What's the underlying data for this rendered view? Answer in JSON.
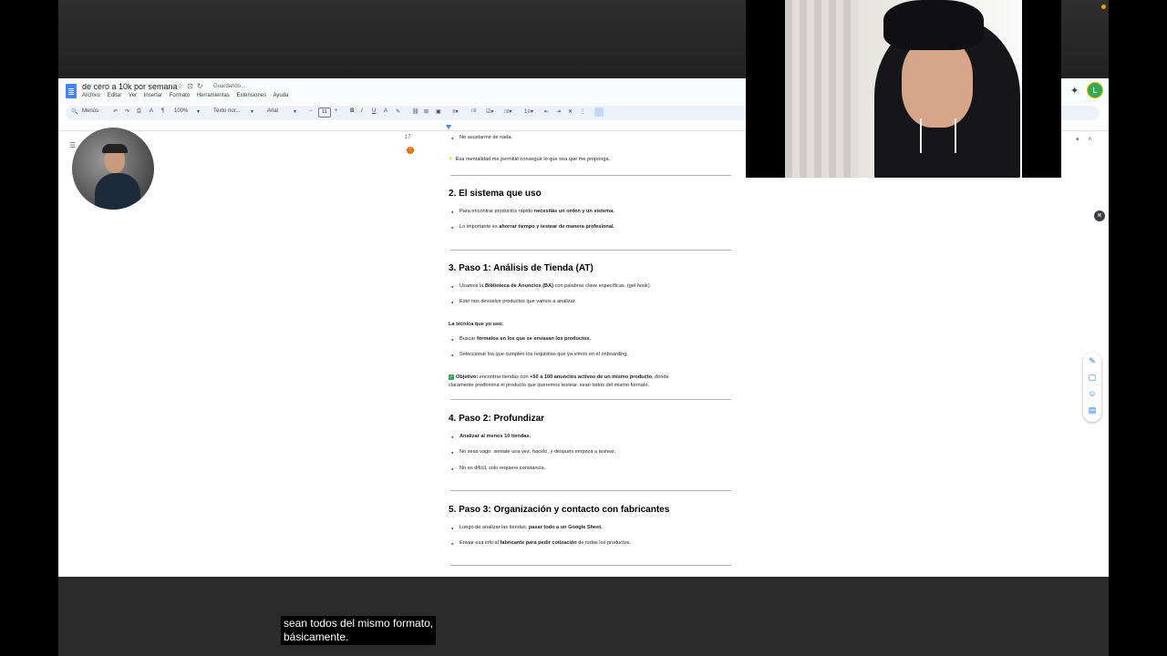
{
  "doc": {
    "title": "de cero a 10k por semana",
    "saving_status": "Guardando...",
    "menu": [
      "Archivo",
      "Editar",
      "Ver",
      "Insertar",
      "Formato",
      "Herramientas",
      "Extensiones",
      "Ayuda"
    ],
    "toolbar": {
      "search": "Menús",
      "zoom": "100%",
      "style": "Texto nor...",
      "font": "Arial",
      "font_size": "11"
    },
    "user_initial": "L",
    "page_number": "17"
  },
  "content": {
    "line_top": "No asustarme de nada.",
    "mentality": "Esa mentalidad me permitió conseguir lo que sea que me proponga.",
    "section2": {
      "heading": "2. El sistema que uso",
      "b1_pre": "Para encontrar productos rápido ",
      "b1_bold": "necesitás un orden y un sistema.",
      "b2_pre": "Lo importante es ",
      "b2_bold": "ahorrar tiempo y testear de manera profesional."
    },
    "section3": {
      "heading": "3. Paso 1: Análisis de Tienda (AT)",
      "b1_pre": "Usamos la ",
      "b1_bold": "Biblioteca de Anuncios (BA)",
      "b1_post": " con palabras clave específicas. (gel hook)",
      "b2": "Esto nos devuelve productos que vamos a analizar.",
      "technique_label": "La técnica que yo uso:",
      "t1_pre": "Buscar ",
      "t1_bold": "formatos en los que se envasan los productos.",
      "t2": "Seleccionar los que cumplen los requisitos que ya vimos en el onboarding.",
      "obj_label": "Objetivo:",
      "obj_pre": " encontrar tiendas con ",
      "obj_bold": "+50 a 100 anuncios activos de un mismo producto",
      "obj_post": ", donde",
      "obj_line2": "claramente predomina el producto que queremos testear. sean todos del mismo formato."
    },
    "section4": {
      "heading": "4. Paso 2: Profundizar",
      "b1": "Analizar al menos 10 tiendas.",
      "b2": "No seas vago: sentate una vez, hacelo, y después empezá a testear.",
      "b3": "No es difícil, solo requiere constancia."
    },
    "section5": {
      "heading": "5. Paso 3: Organización y contacto con fabricantes",
      "b1_pre": "Luego de analizar las tiendas, ",
      "b1_bold": "pasar todo a un Google Sheet.",
      "b2_pre": "Enviar esa info al ",
      "b2_bold": "fabricante para pedir cotización",
      "b2_post": " de todos los productos."
    }
  },
  "caption": {
    "line1": "sean todos del mismo formato,",
    "line2": "básicamente."
  },
  "colors": {
    "docs_blue": "#4285f4",
    "toolbar_bg": "#edf2fa",
    "avatar_green": "#34a853",
    "check_green": "#34a853"
  }
}
